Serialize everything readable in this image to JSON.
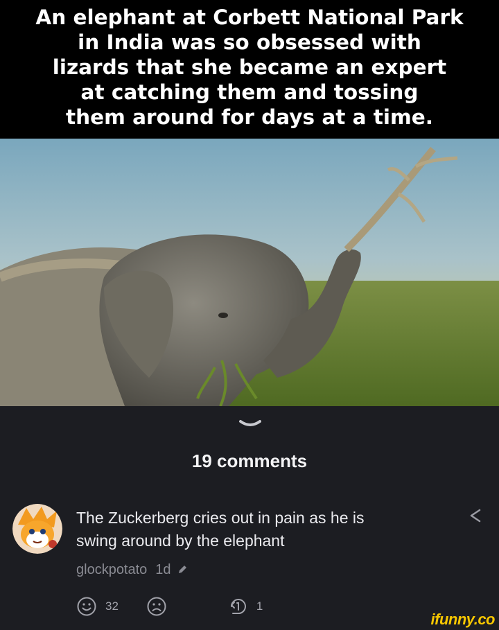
{
  "meme": {
    "caption": "An elephant at Corbett National Park\nin India was so obsessed with\nlizards that she became an expert\nat catching them and tossing\nthem around for days at a time."
  },
  "photo": {
    "subject": "elephant-with-lizard-photo"
  },
  "comments": {
    "count_label": "19 comments",
    "collapse_icon": "chevron-down-icon"
  },
  "comment": {
    "text": "The Zuckerberg cries out in pain as he is\nswing around by the elephant",
    "author": "glockpotato",
    "time": "1d",
    "smile_count": "32",
    "reply_count": "1"
  },
  "branding": {
    "watermark": "ifunny.co"
  },
  "colors": {
    "background": "#1c1d22",
    "caption_bg": "#000000",
    "watermark": "#f7c700",
    "meta_text": "#8a8b93"
  }
}
